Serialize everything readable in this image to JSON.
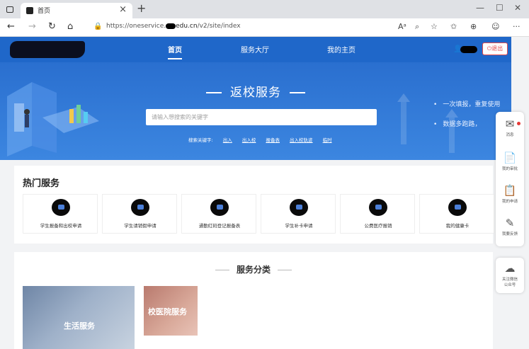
{
  "browser": {
    "tab_title": "首页",
    "tab_close": "×",
    "new_tab": "+",
    "url_prefix": "https://oneservice.",
    "url_host": "edu.cn",
    "url_path": "/v2/site/index",
    "window_controls": [
      "—",
      "☐",
      "✕"
    ],
    "nav_icons": [
      "back-icon",
      "forward-icon",
      "reload-icon",
      "home-icon"
    ],
    "nav_glyphs": [
      "←",
      "→",
      "↻",
      "⌂"
    ],
    "extension_glyphs": [
      "Aᵃ",
      "⌕",
      "☆",
      "✩",
      "⊕",
      "☺",
      "···"
    ]
  },
  "header": {
    "nav": [
      {
        "label": "首页",
        "active": true
      },
      {
        "label": "服务大厅",
        "active": false
      },
      {
        "label": "我的主页",
        "active": false
      }
    ],
    "logout_label": "⏻退出",
    "brand_color": "#1f67c9"
  },
  "banner": {
    "title": "返校服务",
    "search_placeholder": "请输入想搜索的关键字",
    "keywords_label": "搜索关键字:",
    "keywords": [
      "出入",
      "出入校",
      "报备表",
      "出入校轨迹",
      "临时"
    ],
    "slogans": [
      "一次填报，重复使用",
      "数据多跑路，"
    ]
  },
  "sidebar": {
    "items": [
      {
        "icon": "notice-icon",
        "glyph": "✉",
        "label": "消息",
        "badge": true
      },
      {
        "icon": "approval-icon",
        "glyph": "📄",
        "label": "我的审批",
        "badge": false
      },
      {
        "icon": "application-icon",
        "glyph": "📋",
        "label": "我的申请",
        "badge": false
      },
      {
        "icon": "feedback-icon",
        "glyph": "✎",
        "label": "我要反馈",
        "badge": false
      }
    ],
    "wechat": {
      "icon": "wechat-icon",
      "glyph": "☁",
      "label_line1": "关注微信",
      "label_line2": "公众号"
    }
  },
  "hot_services": {
    "title": "热门服务",
    "items": [
      "学生报备和出校申请",
      "学生请销假申请",
      "通勤红码登记报备表",
      "学生补卡申请",
      "公费医疗报销",
      "我的健康卡"
    ]
  },
  "categories": {
    "title": "服务分类",
    "tiles": [
      {
        "label": "生活服务"
      },
      {
        "label": "校医院服务"
      }
    ]
  }
}
